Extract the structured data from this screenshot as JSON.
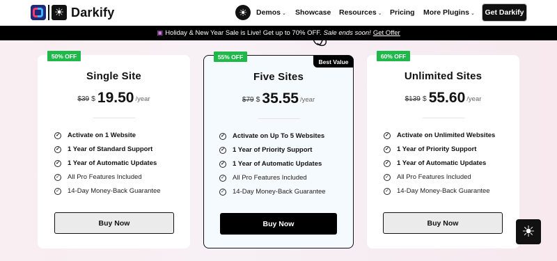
{
  "header": {
    "brand": "Darkify",
    "nav": [
      {
        "label": "Demos",
        "dropdown": true
      },
      {
        "label": "Showcase",
        "dropdown": false
      },
      {
        "label": "Resources",
        "dropdown": true
      },
      {
        "label": "Pricing",
        "dropdown": false
      },
      {
        "label": "More Plugins",
        "dropdown": true
      }
    ],
    "cta": "Get Darkify"
  },
  "banner": {
    "text": "Holiday & New Year Sale is Live! Get up to 70% OFF.",
    "ends": "Sale ends soon!",
    "link": "Get Offer"
  },
  "plans": [
    {
      "badge": "50% OFF",
      "title": "Single Site",
      "old_price": "$39",
      "currency": "$",
      "price": "19.50",
      "period": "/year",
      "features": [
        {
          "text": "Activate on 1 Website",
          "bold": true
        },
        {
          "text": "1 Year of Standard Support",
          "bold": true
        },
        {
          "text": "1 Year of Automatic Updates",
          "bold": true
        },
        {
          "text": "All Pro Features Included",
          "bold": false
        },
        {
          "text": "14-Day Money-Back Guarantee",
          "bold": false
        }
      ],
      "button": "Buy Now"
    },
    {
      "badge": "55% OFF",
      "ribbon": "Best Value",
      "title": "Five Sites",
      "old_price": "$79",
      "currency": "$",
      "price": "35.55",
      "period": "/year",
      "features": [
        {
          "text": "Activate on Up To 5 Websites",
          "bold": true
        },
        {
          "text": "1 Year of Priority Support",
          "bold": true
        },
        {
          "text": "1 Year of Automatic Updates",
          "bold": true
        },
        {
          "text": "All Pro Features Included",
          "bold": false
        },
        {
          "text": "14-Day Money-Back Guarantee",
          "bold": false
        }
      ],
      "button": "Buy Now"
    },
    {
      "badge": "60% OFF",
      "title": "Unlimited Sites",
      "old_price": "$139",
      "currency": "$",
      "price": "55.60",
      "period": "/year",
      "features": [
        {
          "text": "Activate on Unlimited Websites",
          "bold": true
        },
        {
          "text": "1 Year of Priority Support",
          "bold": true
        },
        {
          "text": "1 Year of Automatic Updates",
          "bold": true
        },
        {
          "text": "All Pro Features Included",
          "bold": false
        },
        {
          "text": "14-Day Money-Back Guarantee",
          "bold": false
        }
      ],
      "button": "Buy Now"
    }
  ],
  "colors": {
    "accent": "#000000",
    "badge": "#1fb84b",
    "highlight_card": "#f4fafd"
  }
}
